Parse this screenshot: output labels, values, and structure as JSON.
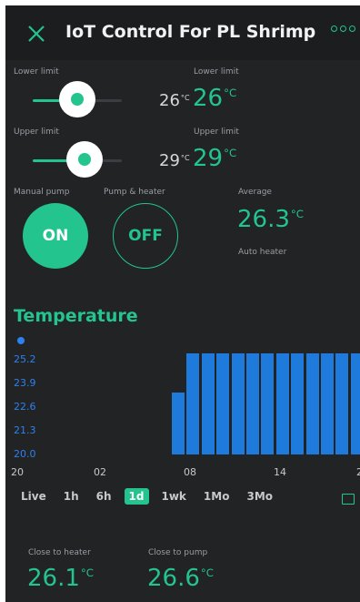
{
  "header": {
    "title": "IoT Control For PL Shrimp",
    "close_icon": "close-icon",
    "menu_icon": "more-icon"
  },
  "colors": {
    "accent": "#23c48e",
    "chart": "#1e7bdc",
    "background": "#212325"
  },
  "lower_limit": {
    "label": "Lower limit",
    "slider_value": "26",
    "unit": "°C",
    "display_label": "Lower limit",
    "display_value": "26",
    "display_unit": "°C",
    "slider_level_fraction": 0.5
  },
  "upper_limit": {
    "label": "Upper limit",
    "slider_value": "29",
    "unit": "°C",
    "display_label": "Upper limit",
    "display_value": "29",
    "display_unit": "°C",
    "slider_level_fraction": 0.58
  },
  "manual_pump": {
    "label": "Manual pump",
    "state": "ON"
  },
  "pump_heater": {
    "label": "Pump & heater",
    "state": "OFF"
  },
  "average": {
    "label": "Average",
    "value": "26.3",
    "unit": "°C",
    "status": "Auto heater"
  },
  "chart_data": {
    "type": "bar",
    "title": "Temperature",
    "yticks": [
      "25.2",
      "23.9",
      "22.6",
      "21.3",
      "20.0"
    ],
    "xticks": [
      "20",
      "02",
      "08",
      "14",
      "2"
    ],
    "ylim": [
      20.0,
      25.2
    ],
    "values": [
      23.2,
      25.2,
      25.2,
      25.2,
      25.2,
      25.2,
      25.2,
      25.2,
      25.2,
      25.2,
      25.2,
      25.2,
      25.2
    ],
    "series_color": "#1e7bdc",
    "grid": false
  },
  "time_ranges": {
    "items": [
      "Live",
      "1h",
      "6h",
      "1d",
      "1wk",
      "1Mo",
      "3Mo"
    ],
    "selected": "1d"
  },
  "close_to_heater": {
    "label": "Close to heater",
    "value": "26.1",
    "unit": "°C"
  },
  "close_to_pump": {
    "label": "Close to pump",
    "value": "26.6",
    "unit": "°C"
  }
}
